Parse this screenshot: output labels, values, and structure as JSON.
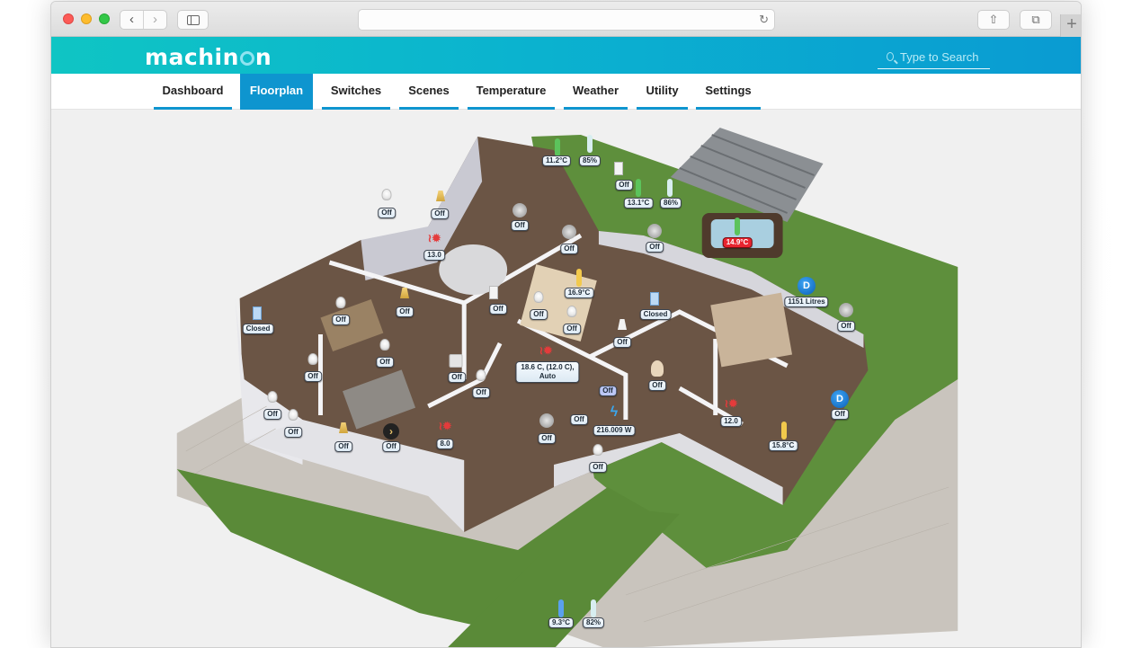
{
  "browser": {
    "url": "",
    "icons": {
      "back": "chevron-left-icon",
      "forward": "chevron-right-icon",
      "sidebar": "sidebar-icon",
      "reload": "reload-icon",
      "share": "share-icon",
      "tabs": "tabs-overview-icon",
      "new_tab": "plus-icon"
    },
    "back_glyph": "‹",
    "forward_glyph": "›",
    "reload_glyph": "↻",
    "share_glyph": "⇧",
    "tabs_glyph": "⧉",
    "new_tab_glyph": "+"
  },
  "app": {
    "logo_prefix": "machin",
    "logo_suffix": "n",
    "search_placeholder": "Type to Search",
    "accent_color": "#0e95cf",
    "header_gradient": [
      "#0fc5c4",
      "#0a9bd2"
    ]
  },
  "nav": {
    "active": "Floorplan",
    "tabs": [
      {
        "label": "Dashboard"
      },
      {
        "label": "Floorplan"
      },
      {
        "label": "Switches"
      },
      {
        "label": "Scenes"
      },
      {
        "label": "Temperature"
      },
      {
        "label": "Weather"
      },
      {
        "label": "Utility"
      },
      {
        "label": "Settings"
      }
    ]
  },
  "floorplan": {
    "devices": [
      {
        "name": "outdoor-temp-north",
        "type": "thermometer",
        "label": "11.2°C",
        "color": "#5cc35c"
      },
      {
        "name": "outdoor-humidity-north",
        "type": "humidity",
        "label": "85%"
      },
      {
        "name": "outdoor-light-north",
        "type": "wall-light",
        "label": "Off"
      },
      {
        "name": "outdoor-temp-garden",
        "type": "thermometer",
        "label": "13.1°C",
        "color": "#5cc35c"
      },
      {
        "name": "outdoor-humidity-garden",
        "type": "humidity",
        "label": "86%"
      },
      {
        "name": "hot-tub-temp",
        "type": "thermometer",
        "label": "14.9°C",
        "color": "#5cc35c",
        "alert": true
      },
      {
        "name": "garden-fan",
        "type": "fan",
        "label": "Off"
      },
      {
        "name": "water-meter",
        "type": "water",
        "label": "1151 Litres"
      },
      {
        "name": "garden-fan-east",
        "type": "fan",
        "label": "Off"
      },
      {
        "name": "lounge-bulb",
        "type": "bulb",
        "label": "Off"
      },
      {
        "name": "lounge-lamp",
        "type": "lamp",
        "label": "Off"
      },
      {
        "name": "lounge-heater",
        "type": "heating",
        "label": "13.0"
      },
      {
        "name": "lounge-fan",
        "type": "fan",
        "label": "Off"
      },
      {
        "name": "kitchen-fan",
        "type": "fan",
        "label": "Off"
      },
      {
        "name": "kitchen-temp",
        "type": "thermometer",
        "label": "16.9°C",
        "color": "#f2c94c"
      },
      {
        "name": "kitchen-wall-light",
        "type": "wall-light",
        "label": "Off"
      },
      {
        "name": "kitchen-bulb-1",
        "type": "bulb",
        "label": "Off"
      },
      {
        "name": "kitchen-bulb-2",
        "type": "bulb",
        "label": "Off"
      },
      {
        "name": "hall-door",
        "type": "door",
        "label": "Closed"
      },
      {
        "name": "side-door",
        "type": "door",
        "label": "Closed"
      },
      {
        "name": "dining-bulb-1",
        "type": "bulb",
        "label": "Off"
      },
      {
        "name": "dining-lamp",
        "type": "lamp",
        "label": "Off"
      },
      {
        "name": "dining-bulb-2",
        "type": "bulb",
        "label": "Off"
      },
      {
        "name": "dining-bulb-3",
        "type": "bulb",
        "label": "Off"
      },
      {
        "name": "utility-light",
        "type": "lamp-shade",
        "label": "Off"
      },
      {
        "name": "hall-thermostat",
        "type": "heating",
        "label_lines": [
          "18.6 C, (12.0 C),",
          "Auto"
        ]
      },
      {
        "name": "socket",
        "type": "socket",
        "label": "Off"
      },
      {
        "name": "hall-bulb",
        "type": "bulb",
        "label": "Off"
      },
      {
        "name": "stairs-light",
        "type": "stairs",
        "label": "Off",
        "highlight": true
      },
      {
        "name": "bathroom-light",
        "type": "figure",
        "label": "Off"
      },
      {
        "name": "living-bulb-1",
        "type": "bulb",
        "label": "Off"
      },
      {
        "name": "living-bulb-2",
        "type": "bulb",
        "label": "Off"
      },
      {
        "name": "living-lamp",
        "type": "lamp",
        "label": "Off"
      },
      {
        "name": "living-blinds",
        "type": "blinds",
        "label": "Off"
      },
      {
        "name": "study-heater",
        "type": "heating",
        "label": "8.0"
      },
      {
        "name": "entrance-fan",
        "type": "fan",
        "label": "Off"
      },
      {
        "name": "entrance-light",
        "type": "light",
        "label": "Off"
      },
      {
        "name": "power-meter",
        "type": "power",
        "label": "216.009 W"
      },
      {
        "name": "porch-bulb",
        "type": "bulb",
        "label": "Off"
      },
      {
        "name": "bedroom-heater",
        "type": "heating",
        "label": "12.0"
      },
      {
        "name": "bedroom-temp",
        "type": "thermometer",
        "label": "15.8°C",
        "color": "#f2c94c"
      },
      {
        "name": "bedroom-water-valve",
        "type": "water",
        "label": "Off"
      },
      {
        "name": "outdoor-temp-south",
        "type": "thermometer",
        "label": "9.3°C",
        "color": "#5aa0ee"
      },
      {
        "name": "outdoor-humidity-south",
        "type": "humidity",
        "label": "82%"
      }
    ]
  }
}
